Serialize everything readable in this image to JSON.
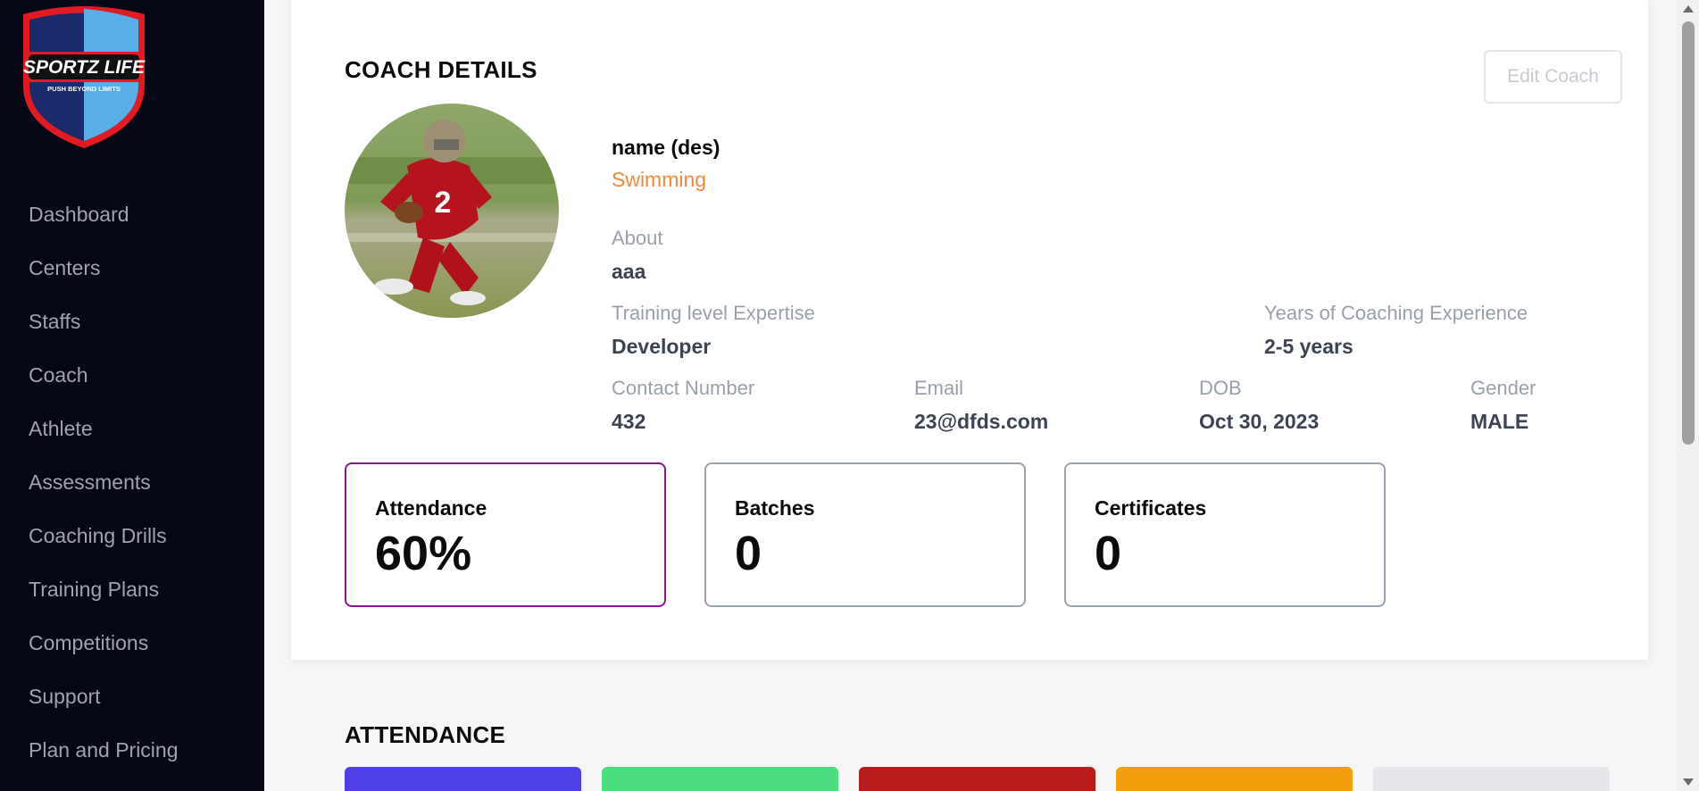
{
  "logo": {
    "title": "SPORTZ LIFE",
    "tagline": "PUSH BEYOND LIMITS"
  },
  "sidebar": {
    "items": [
      {
        "label": "Dashboard"
      },
      {
        "label": "Centers"
      },
      {
        "label": "Staffs"
      },
      {
        "label": "Coach"
      },
      {
        "label": "Athlete"
      },
      {
        "label": "Assessments"
      },
      {
        "label": "Coaching Drills"
      },
      {
        "label": "Training Plans"
      },
      {
        "label": "Competitions"
      },
      {
        "label": "Support"
      },
      {
        "label": "Plan and Pricing"
      }
    ]
  },
  "coach": {
    "section_title": "COACH DETAILS",
    "edit_label": "Edit Coach",
    "name": "name (des)",
    "sport": "Swimming",
    "about_label": "About",
    "about_value": "aaa",
    "training_label": "Training level Expertise",
    "training_value": "Developer",
    "experience_label": "Years of Coaching Experience",
    "experience_value": "2-5 years",
    "contact_label": "Contact Number",
    "contact_value": "432",
    "email_label": "Email",
    "email_value": "23@dfds.com",
    "dob_label": "DOB",
    "dob_value": "Oct 30, 2023",
    "gender_label": "Gender",
    "gender_value": "MALE"
  },
  "stats": [
    {
      "label": "Attendance",
      "value": "60%"
    },
    {
      "label": "Batches",
      "value": "0"
    },
    {
      "label": "Certificates",
      "value": "0"
    }
  ],
  "attendance": {
    "section_title": "ATTENDANCE",
    "tile_colors": [
      "#4f3fe6",
      "#4ade80",
      "#b91c1c",
      "#f59e0b",
      "#e5e7eb"
    ]
  },
  "colors": {
    "sidebar_bg": "#050814",
    "sport_accent": "#f0883a",
    "active_card_border": "#8a158e"
  }
}
